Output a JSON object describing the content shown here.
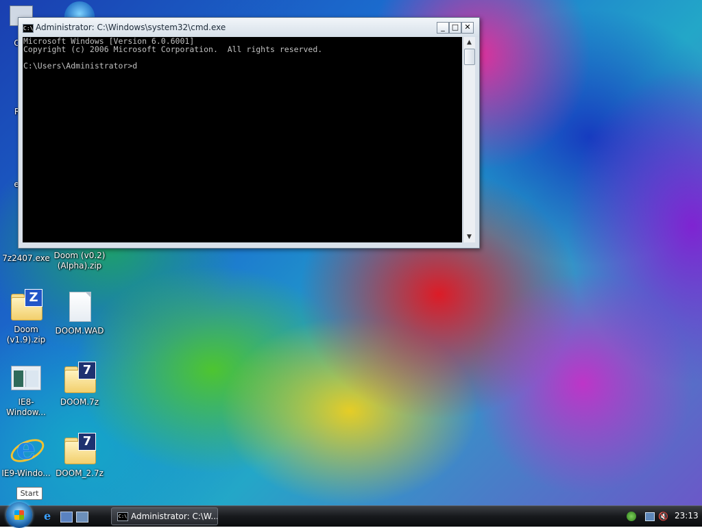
{
  "desktop": {
    "icons": [
      {
        "label": "Co"
      },
      {
        "label": "Re"
      },
      {
        "label": "eX"
      },
      {
        "label": "7z2407.exe"
      },
      {
        "label": "Doom (v0.2)\n(Alpha).zip"
      },
      {
        "label": "Doom\n(v1.9).zip"
      },
      {
        "label": "DOOM.WAD"
      },
      {
        "label": "IE8-Window..."
      },
      {
        "label": "DOOM.7z"
      },
      {
        "label": "IE9-Windo..."
      },
      {
        "label": "DOOM_2.7z"
      }
    ]
  },
  "cmd_window": {
    "title": "Administrator: C:\\Windows\\system32\\cmd.exe",
    "icon": "cmd-icon",
    "minimize": "_",
    "maximize": "□",
    "close": "✕",
    "console_lines": [
      "Microsoft Windows [Version 6.0.6001]",
      "Copyright (c) 2006 Microsoft Corporation.  All rights reserved.",
      "",
      "C:\\Users\\Administrator>d"
    ]
  },
  "tooltip": {
    "start": "Start"
  },
  "taskbar": {
    "task_cmd_label": "Administrator: C:\\W...",
    "clock": "23:13"
  }
}
